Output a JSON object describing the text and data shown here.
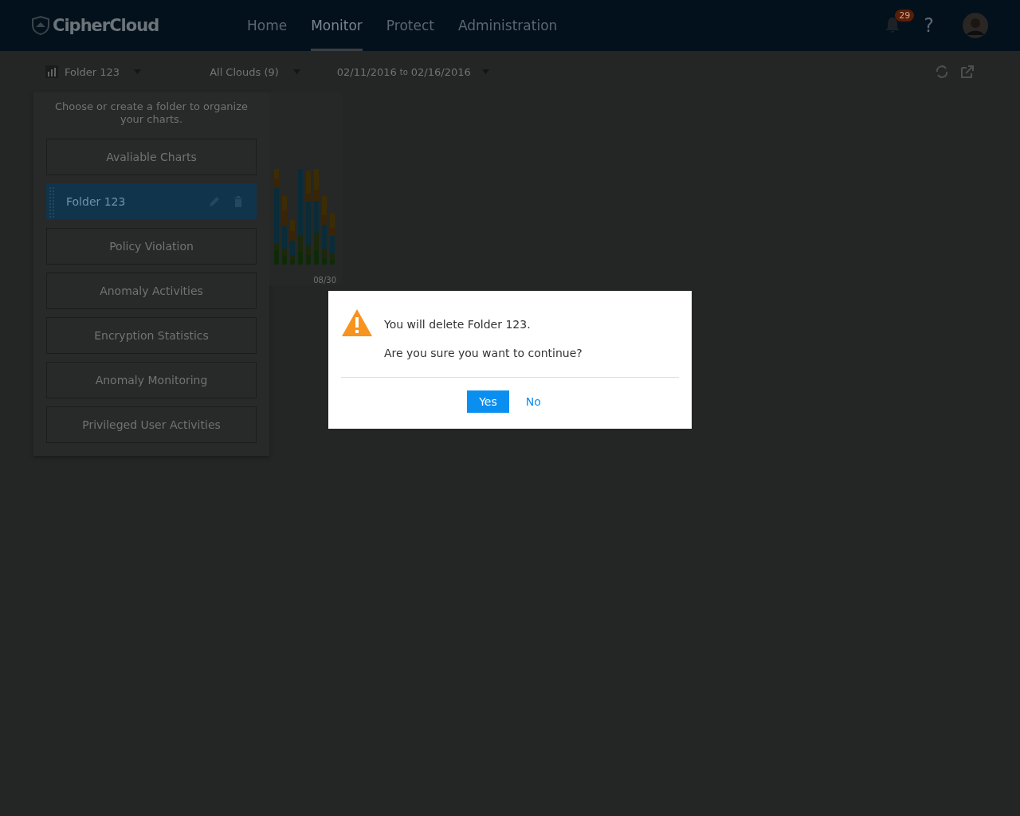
{
  "header": {
    "logo": "CipherCloud",
    "nav": [
      {
        "label": "Home",
        "selected": false
      },
      {
        "label": "Monitor",
        "selected": true
      },
      {
        "label": "Protect",
        "selected": false
      },
      {
        "label": "Administration",
        "selected": false
      }
    ],
    "notifications": "29",
    "help": "?"
  },
  "toolbar": {
    "folder": "Folder 123",
    "clouds": "All Clouds (9)",
    "date_from": "02/11/2016",
    "date_to_word": "to",
    "date_to": "02/16/2016"
  },
  "folder_panel": {
    "hint": "Choose or create a folder to organize your charts.",
    "items": [
      {
        "label": "Avaliable Charts",
        "selected": false
      },
      {
        "label": "Folder 123",
        "selected": true
      },
      {
        "label": "Policy Violation",
        "selected": false
      },
      {
        "label": "Anomaly Activities",
        "selected": false
      },
      {
        "label": "Encryption Statistics",
        "selected": false
      },
      {
        "label": "Anomaly Monitoring",
        "selected": false
      },
      {
        "label": "Privileged User Activities",
        "selected": false
      }
    ]
  },
  "chart_fragment": {
    "axis_label": "08/30"
  },
  "dialog": {
    "message": "You will delete Folder 123.",
    "question": "Are you sure you want to continue?",
    "buttons": [
      {
        "label": "Yes",
        "kind": "primary"
      },
      {
        "label": "No",
        "kind": "link"
      }
    ]
  }
}
